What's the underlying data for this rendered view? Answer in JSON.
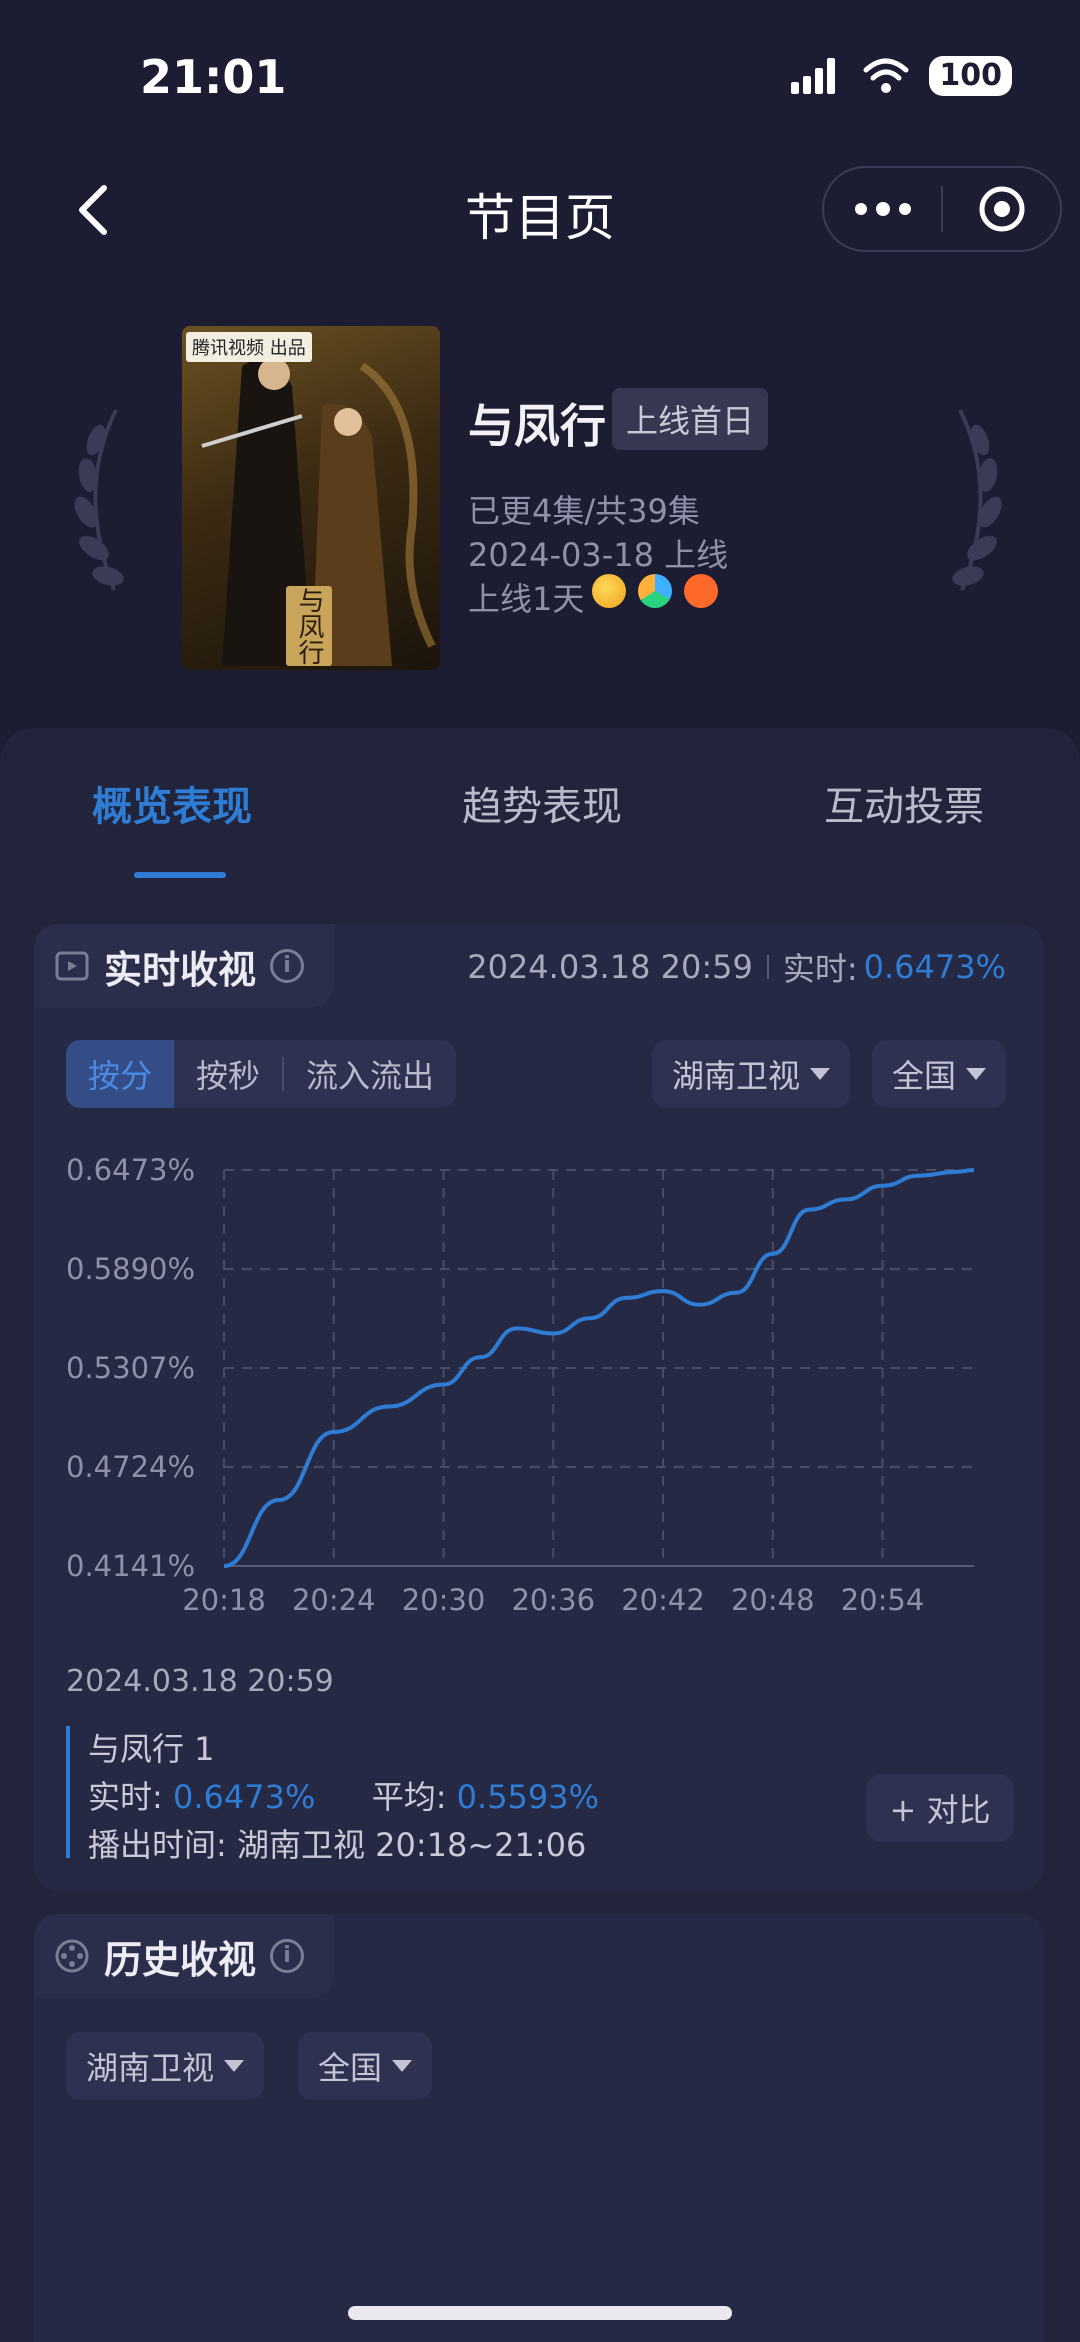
{
  "status_bar": {
    "time": "21:01",
    "battery": "100"
  },
  "nav": {
    "title": "节目页"
  },
  "show": {
    "title": "与凤行",
    "tag": "上线首日",
    "episodes": "已更4集/共39集",
    "release": "2024-03-18 上线",
    "days_online": "上线1天",
    "poster_badge": "腾讯视频 出品",
    "poster_seal": "与凤行",
    "platforms": [
      "mango-tv-icon",
      "tencent-video-icon",
      "mgtv-icon"
    ]
  },
  "tabs": [
    {
      "label": "概览表现",
      "active": true
    },
    {
      "label": "趋势表现",
      "active": false
    },
    {
      "label": "互动投票",
      "active": false
    }
  ],
  "realtime": {
    "title": "实时收视",
    "timestamp": "2024.03.18 20:59",
    "realtime_label": "实时:",
    "realtime_value": "0.6473%",
    "modes": [
      "按分",
      "按秒",
      "流入流出"
    ],
    "channel": "湖南卫视",
    "region": "全国"
  },
  "chart_data": {
    "type": "line",
    "x": [
      "20:18",
      "20:21",
      "20:24",
      "20:27",
      "20:30",
      "20:32",
      "20:34",
      "20:36",
      "20:38",
      "20:40",
      "20:42",
      "20:44",
      "20:46",
      "20:48",
      "20:50",
      "20:52",
      "20:54",
      "20:56",
      "20:58",
      "20:59"
    ],
    "y_ticks": [
      "0.6473%",
      "0.5890%",
      "0.5307%",
      "0.4724%",
      "0.4141%"
    ],
    "x_ticks": [
      "20:18",
      "20:24",
      "20:30",
      "20:36",
      "20:42",
      "20:48",
      "20:54"
    ],
    "series": [
      {
        "values": [
          0.4141,
          0.453,
          0.493,
          0.508,
          0.521,
          0.537,
          0.554,
          0.551,
          0.56,
          0.572,
          0.576,
          0.568,
          0.575,
          0.598,
          0.624,
          0.63,
          0.638,
          0.644,
          0.6462,
          0.6473
        ]
      }
    ],
    "ylim": [
      0.4141,
      0.6473
    ],
    "xlim_minutes": [
      0,
      41
    ],
    "grid": true,
    "color": "#2f7cd5"
  },
  "legend": {
    "date": "2024.03.18 20:59",
    "series_name": "与凤行 1",
    "realtime_label": "实时:",
    "realtime_value": "0.6473%",
    "avg_label": "平均:",
    "avg_value": "0.5593%",
    "airtime": "播出时间:  湖南卫视 20:18~21:06",
    "compare": "+ 对比"
  },
  "history": {
    "title": "历史收视",
    "channel": "湖南卫视",
    "region": "全国"
  }
}
